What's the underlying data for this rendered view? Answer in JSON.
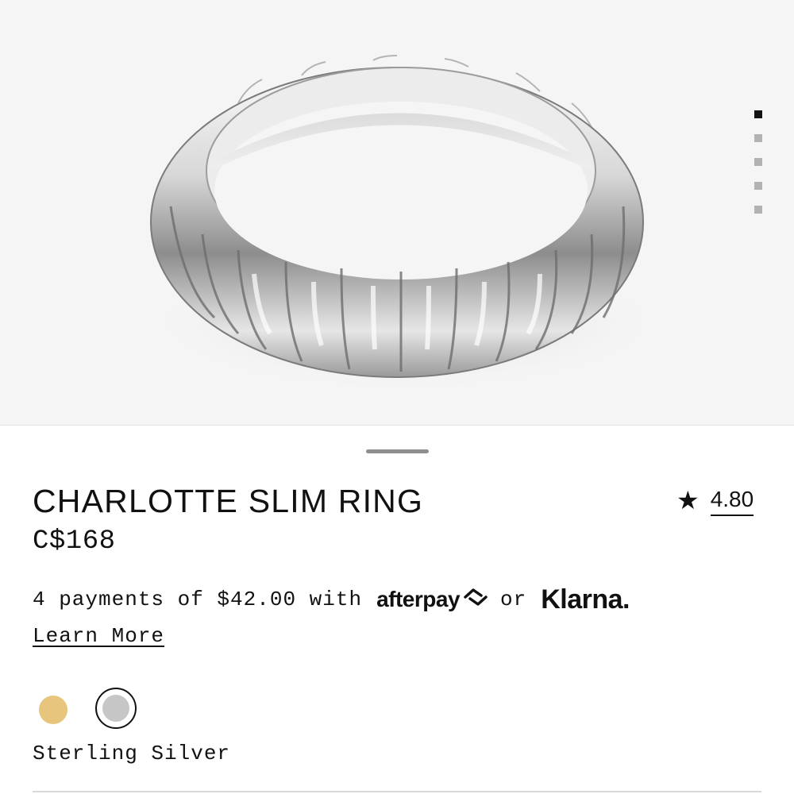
{
  "product": {
    "title": "CHARLOTTE SLIM RING",
    "price": "C$168",
    "rating": "4.80",
    "rating_icon": "star-icon"
  },
  "gallery": {
    "image": "silver ribbed ring",
    "slide_count": 5,
    "active_slide": 1
  },
  "payments": {
    "prefix": "4 payments of $42.00 with",
    "provider_1": "afterpay",
    "or": "or",
    "provider_2": "Klarna.",
    "learn_more": "Learn More"
  },
  "variants": {
    "options": [
      {
        "name": "gold",
        "color": "#e8c57c"
      },
      {
        "name": "silver",
        "color": "#c6c6c6"
      }
    ],
    "selected_label": "Sterling Silver"
  },
  "colors": {
    "text": "#111111",
    "gallery_bg": "#f5f5f5"
  }
}
